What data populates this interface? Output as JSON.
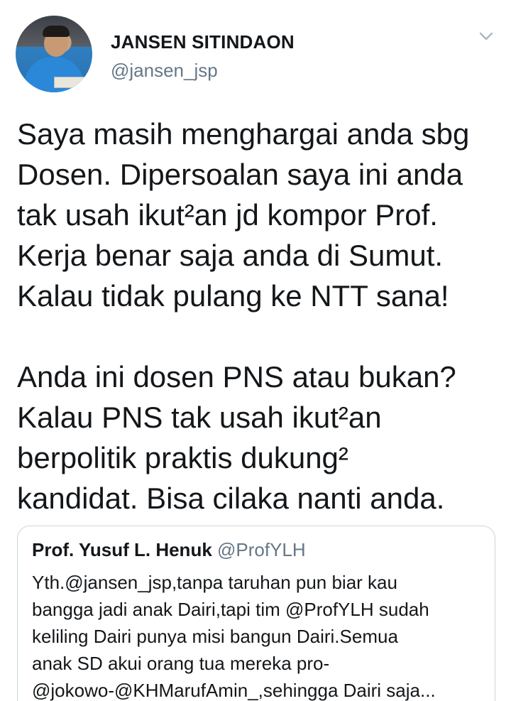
{
  "author": {
    "name": "JANSEN SITINDAON",
    "handle": "@jansen_jsp",
    "avatar_icon": "profile-photo"
  },
  "tweet": {
    "paragraphs": [
      [
        "Saya masih menghargai anda sbg",
        "Dosen. Dipersoalan saya ini anda",
        "tak usah ikut²an jd kompor Prof.",
        "Kerja benar saja anda di Sumut.",
        "Kalau tidak pulang ke NTT sana!"
      ],
      [
        "Anda ini dosen PNS atau bukan?",
        "Kalau PNS tak usah ikut²an",
        "berpolitik praktis dukung²",
        "kandidat. Bisa cilaka nanti anda."
      ]
    ]
  },
  "quoted_tweet": {
    "name": "Prof. Yusuf L. Henuk",
    "handle": "@ProfYLH",
    "lines": [
      "Yth.@jansen_jsp,tanpa taruhan pun biar kau",
      "bangga jadi anak Dairi,tapi tim @ProfYLH sudah",
      "keliling Dairi punya misi bangun Dairi.Semua",
      "anak SD akui orang tua mereka pro-",
      "@jokowo-@KHMarufAmin_,sehingga Dairi saja..."
    ]
  },
  "colors": {
    "text": "#14171a",
    "secondary": "#657786",
    "border": "#ccd6dd"
  }
}
